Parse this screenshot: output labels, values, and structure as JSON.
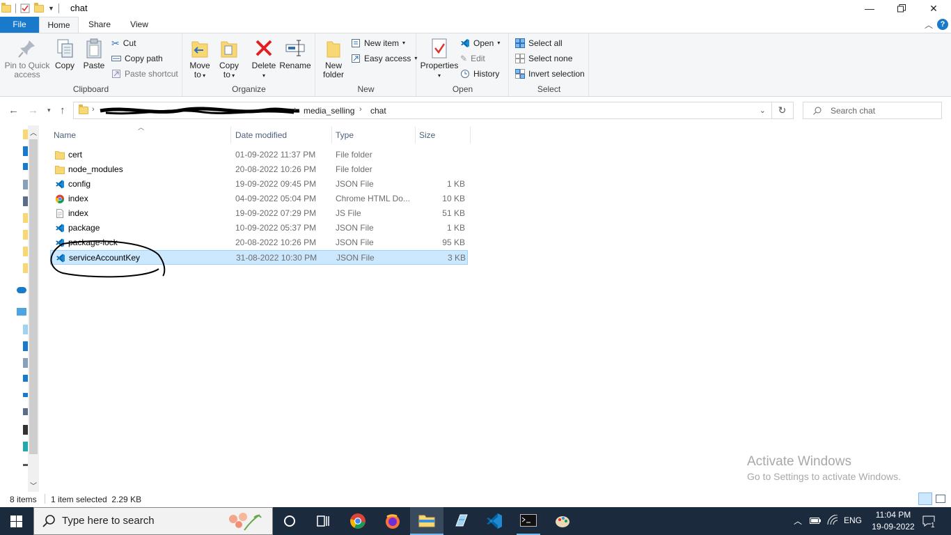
{
  "window": {
    "title": "chat"
  },
  "tabs": {
    "file": "File",
    "home": "Home",
    "share": "Share",
    "view": "View"
  },
  "ribbon": {
    "clipboard": {
      "label": "Clipboard",
      "pin": [
        "Pin to Quick",
        "access"
      ],
      "copy": "Copy",
      "paste": "Paste",
      "cut": "Cut",
      "copy_path": "Copy path",
      "paste_shortcut": "Paste shortcut"
    },
    "organize": {
      "label": "Organize",
      "move_to": [
        "Move",
        "to"
      ],
      "copy_to": [
        "Copy",
        "to"
      ],
      "delete": "Delete",
      "rename": "Rename"
    },
    "new": {
      "label": "New",
      "new_folder": [
        "New",
        "folder"
      ],
      "new_item": "New item",
      "easy_access": "Easy access"
    },
    "open": {
      "label": "Open",
      "properties": "Properties",
      "open": "Open",
      "edit": "Edit",
      "history": "History"
    },
    "select": {
      "label": "Select",
      "select_all": "Select all",
      "select_none": "Select none",
      "invert": "Invert selection"
    }
  },
  "address": {
    "crumbs": [
      "media_selling",
      "chat"
    ],
    "search_placeholder": "Search chat"
  },
  "columns": {
    "name": "Name",
    "date": "Date modified",
    "type": "Type",
    "size": "Size"
  },
  "files": [
    {
      "name": "cert",
      "date": "01-09-2022 11:37 PM",
      "type": "File folder",
      "size": "",
      "icon": "folder-icon"
    },
    {
      "name": "node_modules",
      "date": "20-08-2022 10:26 PM",
      "type": "File folder",
      "size": "",
      "icon": "folder-icon"
    },
    {
      "name": "config",
      "date": "19-09-2022 09:45 PM",
      "type": "JSON File",
      "size": "1 KB",
      "icon": "vscode-icon"
    },
    {
      "name": "index",
      "date": "04-09-2022 05:04 PM",
      "type": "Chrome HTML Do...",
      "size": "10 KB",
      "icon": "chrome-icon"
    },
    {
      "name": "index",
      "date": "19-09-2022 07:29 PM",
      "type": "JS File",
      "size": "51 KB",
      "icon": "js-file-icon"
    },
    {
      "name": "package",
      "date": "10-09-2022 05:37 PM",
      "type": "JSON File",
      "size": "1 KB",
      "icon": "vscode-icon"
    },
    {
      "name": "package-lock",
      "date": "20-08-2022 10:26 PM",
      "type": "JSON File",
      "size": "95 KB",
      "icon": "vscode-icon"
    },
    {
      "name": "serviceAccountKey",
      "date": "31-08-2022 10:30 PM",
      "type": "JSON File",
      "size": "3 KB",
      "icon": "vscode-icon",
      "selected": true
    }
  ],
  "status": {
    "count": "8 items",
    "selection": "1 item selected  2.29 KB"
  },
  "watermark": {
    "title": "Activate Windows",
    "subtitle": "Go to Settings to activate Windows."
  },
  "taskbar": {
    "search_text": "Type here to search",
    "lang": "ENG",
    "time": "11:04 PM",
    "date": "19-09-2022",
    "notifications": "1"
  },
  "colors": {
    "accent": "#1979ca",
    "selection": "#cce8ff",
    "taskbar": "#1b2a3d"
  }
}
